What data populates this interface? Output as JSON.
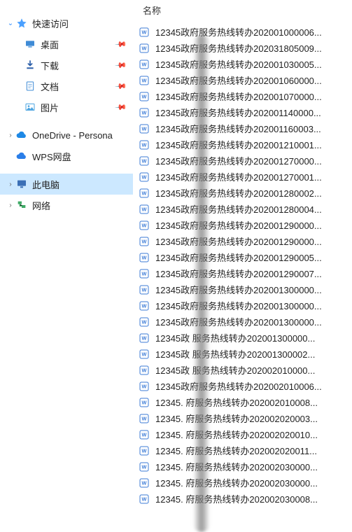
{
  "sidebar": {
    "quick_access_label": "快速访问",
    "items": [
      {
        "label": "桌面",
        "icon": "desktop"
      },
      {
        "label": "下载",
        "icon": "download"
      },
      {
        "label": "文档",
        "icon": "doc"
      },
      {
        "label": "图片",
        "icon": "picture"
      }
    ],
    "onedrive_label": "OneDrive - Persona",
    "wps_label": "WPS网盘",
    "this_pc_label": "此电脑",
    "network_label": "网络"
  },
  "columns": {
    "name": "名称"
  },
  "files": [
    {
      "name": "12345政府服务热线转办202001000006..."
    },
    {
      "name": "12345政府服务热线转办202031805009..."
    },
    {
      "name": "12345政府服务热线转办202001030005..."
    },
    {
      "name": "12345政府服务热线转办202001060000..."
    },
    {
      "name": "12345政府服务热线转办202001070000..."
    },
    {
      "name": "12345政府服务热线转办202001140000..."
    },
    {
      "name": "12345政府服务热线转办202001160003..."
    },
    {
      "name": "12345政府服务热线转办202001210001..."
    },
    {
      "name": "12345政府服务热线转办202001270000..."
    },
    {
      "name": "12345政府服务热线转办202001270001..."
    },
    {
      "name": "12345政府服务热线转办202001280002..."
    },
    {
      "name": "12345政府服务热线转办202001280004..."
    },
    {
      "name": "12345政府服务热线转办202001290000..."
    },
    {
      "name": "12345政府服务热线转办202001290000..."
    },
    {
      "name": "12345政府服务热线转办202001290005..."
    },
    {
      "name": "12345政府服务热线转办202001290007..."
    },
    {
      "name": "12345政府服务热线转办202001300000..."
    },
    {
      "name": "12345政府服务热线转办202001300000..."
    },
    {
      "name": "12345政府服务热线转办202001300000..."
    },
    {
      "name": "12345政  服务热线转办202001300000..."
    },
    {
      "name": "12345政  服务热线转办202001300002..."
    },
    {
      "name": "12345政 服务热线转办202002010000..."
    },
    {
      "name": "12345政府服务热线转办202002010006..."
    },
    {
      "name": "12345. 府服务热线转办202002010008..."
    },
    {
      "name": "12345. 府服务热线转办202002020003..."
    },
    {
      "name": "12345. 府服务热线转办202002020010..."
    },
    {
      "name": "12345. 府服务热线转办202002020011..."
    },
    {
      "name": "12345. 府服务热线转办202002030000..."
    },
    {
      "name": "12345. 府服务热线转办202002030000..."
    },
    {
      "name": "12345. 府服务热线转办202002030008..."
    }
  ]
}
